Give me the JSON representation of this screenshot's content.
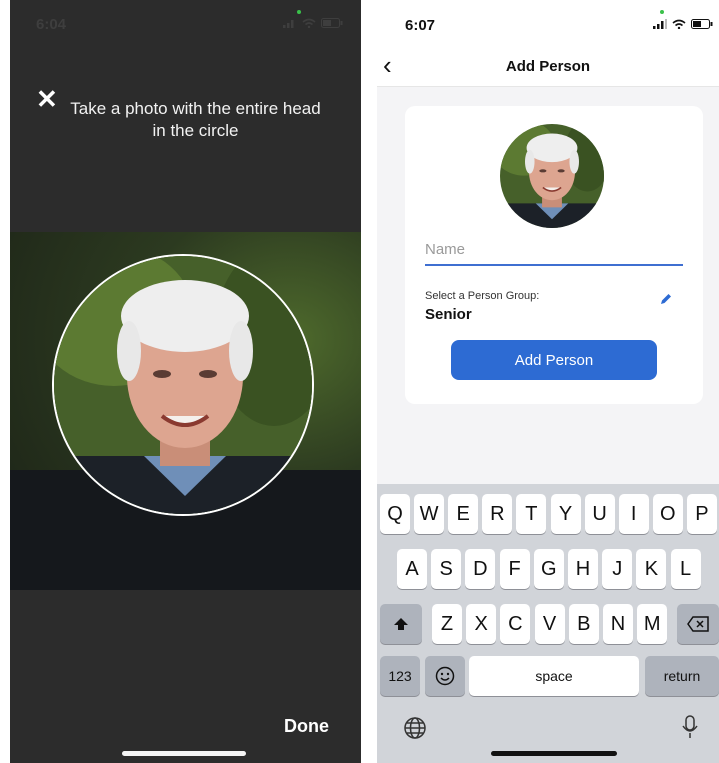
{
  "camera_screen": {
    "status_time": "6:04",
    "instruction": "Take a photo with the entire head in the circle",
    "close_icon": "close-icon",
    "done_label": "Done"
  },
  "add_person_screen": {
    "status_time": "6:07",
    "nav_title": "Add Person",
    "name_placeholder": "Name",
    "group_label": "Select a Person Group:",
    "group_value": "Senior",
    "add_button_label": "Add Person",
    "accent_color": "#2d6bd3"
  },
  "keyboard": {
    "row1": [
      "Q",
      "W",
      "E",
      "R",
      "T",
      "Y",
      "U",
      "I",
      "O",
      "P"
    ],
    "row2": [
      "A",
      "S",
      "D",
      "F",
      "G",
      "H",
      "J",
      "K",
      "L"
    ],
    "row3": [
      "Z",
      "X",
      "C",
      "V",
      "B",
      "N",
      "M"
    ],
    "numbers_key": "123",
    "space_key": "space",
    "return_key": "return"
  }
}
